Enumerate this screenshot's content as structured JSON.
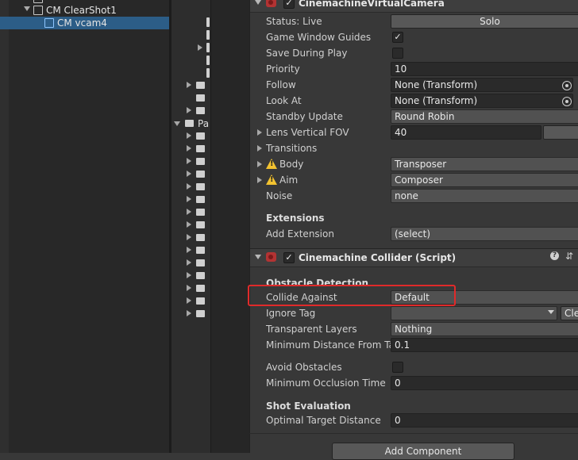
{
  "hierarchy": {
    "items": [
      {
        "label": "CM ClearShot1"
      },
      {
        "label": "CM vcam4"
      }
    ]
  },
  "project": {
    "folder_label": "Pa"
  },
  "vcam": {
    "title": "CinemachineVirtualCamera",
    "status_label": "Status: Live",
    "solo_label": "Solo",
    "game_window_guides_label": "Game Window Guides",
    "game_window_guides_checked": true,
    "save_during_play_label": "Save During Play",
    "priority_label": "Priority",
    "priority_value": "10",
    "follow_label": "Follow",
    "follow_value": "None (Transform)",
    "look_at_label": "Look At",
    "look_at_value": "None (Transform)",
    "standby_label": "Standby Update",
    "standby_value": "Round Robin",
    "fov_label": "Lens Vertical FOV",
    "fov_value": "40",
    "transitions_label": "Transitions",
    "body_label": "Body",
    "body_value": "Transposer",
    "aim_label": "Aim",
    "aim_value": "Composer",
    "noise_label": "Noise",
    "noise_value": "none",
    "extensions_header": "Extensions",
    "add_extension_label": "Add Extension",
    "add_extension_value": "(select)"
  },
  "collider": {
    "title": "Cinemachine Collider (Script)",
    "obstacle_header": "Obstacle Detection",
    "collide_label": "Collide Against",
    "collide_value": "Default",
    "ignore_tag_label": "Ignore Tag",
    "ignore_tag_value": "",
    "clear_label": "Cle",
    "transparent_label": "Transparent Layers",
    "transparent_value": "Nothing",
    "min_dist_label": "Minimum Distance From Tar",
    "min_dist_value": "0.1",
    "avoid_label": "Avoid Obstacles",
    "min_occl_label": "Minimum Occlusion Time",
    "min_occl_value": "0",
    "shot_eval_header": "Shot Evaluation",
    "optimal_label": "Optimal Target Distance",
    "optimal_value": "0"
  },
  "add_component_label": "Add Component",
  "colors": {
    "selection": "#2c5d87",
    "highlight_box": "#e02a2a",
    "warning": "#f2c230"
  }
}
